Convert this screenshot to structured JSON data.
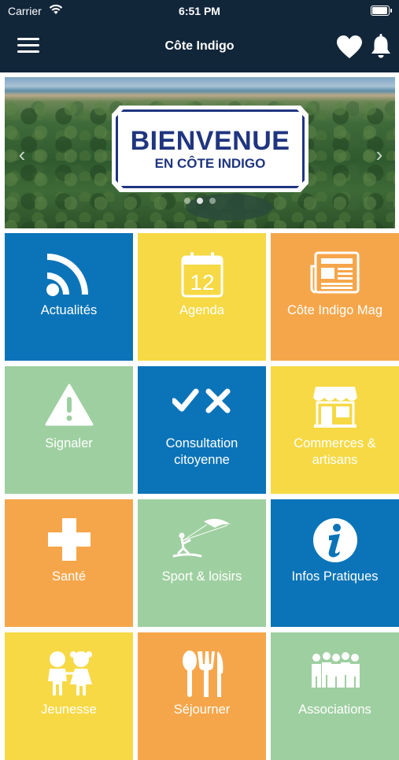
{
  "status": {
    "carrier": "Carrier",
    "time": "6:51 PM"
  },
  "nav": {
    "title": "Côte Indigo",
    "menu_icon": "hamburger-icon",
    "favorites_icon": "heart-icon",
    "notifications_icon": "bell-icon"
  },
  "banner": {
    "sign_line1": "BIENVENUE",
    "sign_line2": "EN CÔTE INDIGO",
    "prev_glyph": "‹",
    "next_glyph": "›",
    "slide_count": 3,
    "active_slide": 1
  },
  "tiles": [
    {
      "label": "Actualités",
      "color": "#0b74b8",
      "icon": "rss-icon"
    },
    {
      "label": "Agenda",
      "color": "#f6d944",
      "icon": "calendar-icon",
      "icon_text": "12"
    },
    {
      "label": "Côte Indigo Mag",
      "color": "#f6a64a",
      "icon": "newspaper-icon"
    },
    {
      "label": "Signaler",
      "color": "#9ecfa0",
      "icon": "warning-icon"
    },
    {
      "label": "Consultation citoyenne",
      "color": "#0b74b8",
      "icon": "check-cross-icon"
    },
    {
      "label": "Commerces & artisans",
      "color": "#f6d944",
      "icon": "shop-icon"
    },
    {
      "label": "Santé",
      "color": "#f6a64a",
      "icon": "medical-cross-icon"
    },
    {
      "label": "Sport & loisirs",
      "color": "#9ecfa0",
      "icon": "kitesurf-icon"
    },
    {
      "label": "Infos Pratiques",
      "color": "#0b74b8",
      "icon": "info-icon"
    },
    {
      "label": "Jeunesse",
      "color": "#f6d944",
      "icon": "children-icon"
    },
    {
      "label": "Séjourner",
      "color": "#f6a64a",
      "icon": "cutlery-icon"
    },
    {
      "label": "Associations",
      "color": "#9ecfa0",
      "icon": "people-group-icon"
    }
  ]
}
